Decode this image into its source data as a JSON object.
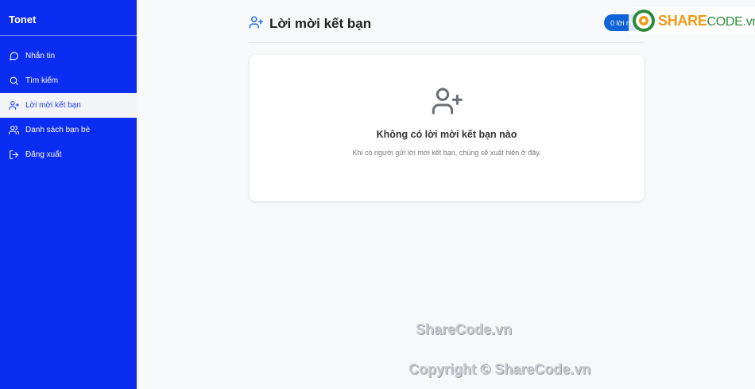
{
  "sidebar": {
    "brand": "Tonet",
    "items": [
      {
        "label": "Nhắn tin",
        "icon": "chat-bubble-icon"
      },
      {
        "label": "Tìm kiếm",
        "icon": "search-icon"
      },
      {
        "label": "Lời mời kết bạn",
        "icon": "user-plus-icon",
        "active": true
      },
      {
        "label": "Danh sách bạn bè",
        "icon": "users-icon"
      },
      {
        "label": "Đăng xuất",
        "icon": "logout-icon"
      }
    ]
  },
  "header": {
    "title": "Lời mời kết bạn",
    "icon": "user-plus-icon",
    "badge": "0 lời mời"
  },
  "empty_state": {
    "icon": "user-plus-icon",
    "title": "Không có lời mời kết bạn nào",
    "description": "Khi có người gửi lời mời kết bạn, chúng sẽ xuất hiện ở đây."
  },
  "watermark": {
    "logo_text_a": "SHARE",
    "logo_text_b": "CODE.vn",
    "line1": "ShareCode.vn",
    "line2": "Copyright © ShareCode.vn"
  },
  "colors": {
    "sidebar_bg": "#0b2cf1",
    "accent": "#1b3ef2",
    "badge_bg": "#0f63d9",
    "page_bg": "#f7f8fa"
  }
}
